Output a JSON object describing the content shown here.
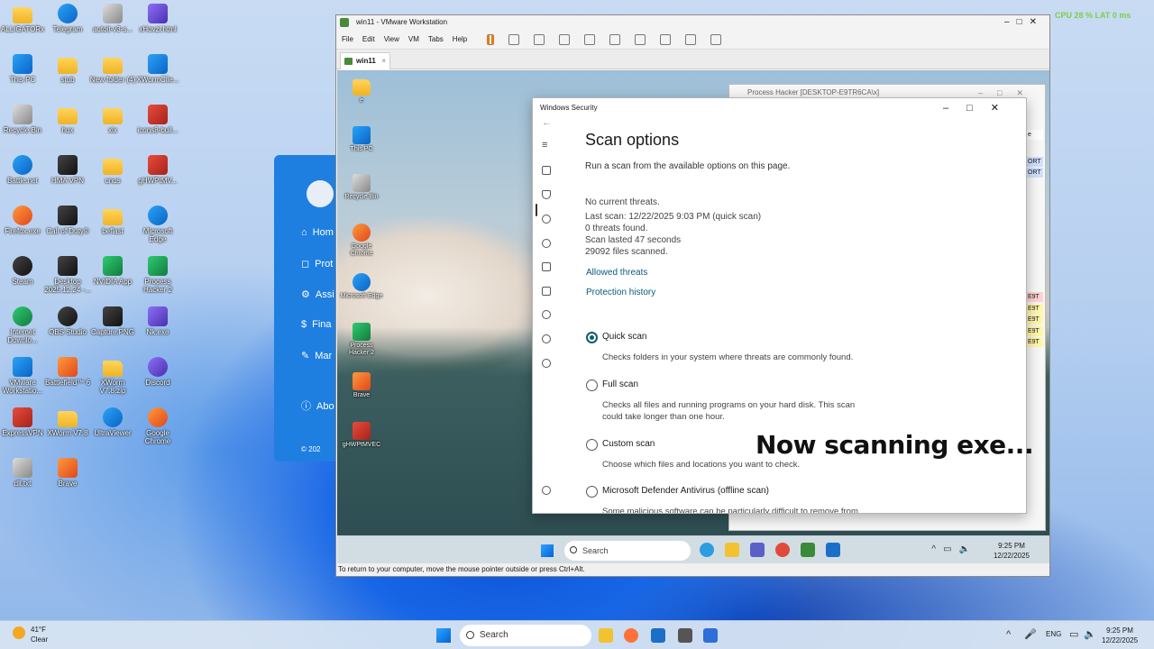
{
  "desktop": {
    "icons": [
      {
        "label": "ALLIGATORx",
        "glyph": "folder"
      },
      {
        "label": "Telegram",
        "glyph": "blue-round"
      },
      {
        "label": "autoit-v3-s...",
        "glyph": "gray"
      },
      {
        "label": "xHovzi.html",
        "glyph": "purple"
      },
      {
        "label": "This PC",
        "glyph": "blue"
      },
      {
        "label": "stub",
        "glyph": "folder"
      },
      {
        "label": "New folder (4)",
        "glyph": "folder"
      },
      {
        "label": "XWormClie...",
        "glyph": "blue"
      },
      {
        "label": "Recycle Bin",
        "glyph": "gray"
      },
      {
        "label": "hux",
        "glyph": "folder"
      },
      {
        "label": "xix",
        "glyph": "folder"
      },
      {
        "label": "icons8-bull...",
        "glyph": "red"
      },
      {
        "label": "Battle.net",
        "glyph": "blue-round"
      },
      {
        "label": "HMA VPN",
        "glyph": "dark"
      },
      {
        "label": "unus",
        "glyph": "folder"
      },
      {
        "label": "gHWPtMV...",
        "glyph": "red"
      },
      {
        "label": "Firefox.exe",
        "glyph": "orange-round"
      },
      {
        "label": "Call of Duty®",
        "glyph": "dark"
      },
      {
        "label": "beflast",
        "glyph": "folder"
      },
      {
        "label": "Microsoft Edge",
        "glyph": "blue-round"
      },
      {
        "label": "Steam",
        "glyph": "dark-round"
      },
      {
        "label": "Desktop 2025.12.24 -...",
        "glyph": "dark"
      },
      {
        "label": "NVIDIA App",
        "glyph": "green"
      },
      {
        "label": "Process Hacker 2",
        "glyph": "green"
      },
      {
        "label": "Internet Downlo...",
        "glyph": "green-round"
      },
      {
        "label": "OBS Studio",
        "glyph": "dark-round"
      },
      {
        "label": "Capture.PNG",
        "glyph": "dark"
      },
      {
        "label": "Nk.exe",
        "glyph": "purple"
      },
      {
        "label": "VMware Workstatio...",
        "glyph": "blue"
      },
      {
        "label": "Battlefield™ 6",
        "glyph": "orange"
      },
      {
        "label": "XWorm V7.8.zip",
        "glyph": "folder"
      },
      {
        "label": "Discord",
        "glyph": "purple-round"
      },
      {
        "label": "ExpressVPN",
        "glyph": "red"
      },
      {
        "label": "XWorm V7.8",
        "glyph": "folder"
      },
      {
        "label": "UltraViewer",
        "glyph": "blue-round"
      },
      {
        "label": "Google Chrome",
        "glyph": "orange-round"
      },
      {
        "label": "dll.txt",
        "glyph": "gray"
      },
      {
        "label": "Brave",
        "glyph": "orange"
      }
    ]
  },
  "side_app": {
    "nav": [
      "Hom",
      "Prot",
      "Assi",
      "Fina",
      "Mar",
      "Abo"
    ],
    "footer": "© 202"
  },
  "vmware": {
    "title": "win11 - VMware Workstation",
    "menu": [
      "File",
      "Edit",
      "View",
      "VM",
      "Tabs",
      "Help"
    ],
    "tab_label": "win11",
    "status_text": "To return to your computer, move the mouse pointer outside or press Ctrl+Alt."
  },
  "guest": {
    "icons": [
      {
        "label": "e",
        "glyph": "folder"
      },
      {
        "label": "This PC",
        "glyph": "blue"
      },
      {
        "label": "Recycle Bin",
        "glyph": "gray"
      },
      {
        "label": "Google Chrome",
        "glyph": "orange-round"
      },
      {
        "label": "Microsoft Edge",
        "glyph": "blue-round"
      },
      {
        "label": "Process Hacker 2",
        "glyph": "green"
      },
      {
        "label": "Brave",
        "glyph": "orange"
      },
      {
        "label": "gHWPtMVEC",
        "glyph": "red"
      }
    ],
    "process_hacker": {
      "title": "Process Hacker [DESKTOP-E9TR6CA\\x]",
      "rows": [
        "e",
        "ORT",
        "ORT",
        "E9T",
        "E9T",
        "E9T",
        "E9T",
        "E9T"
      ]
    },
    "taskbar": {
      "search": "Search",
      "time": "9:25 PM",
      "date": "12/22/2025"
    }
  },
  "windows_security": {
    "window_title": "Windows Security",
    "heading": "Scan options",
    "subtitle": "Run a scan from the available options on this page.",
    "status": [
      "No current threats.",
      "Last scan: 12/22/2025 9:03 PM (quick scan)",
      "0 threats found.",
      "Scan lasted 47 seconds",
      "29092 files scanned."
    ],
    "links": [
      "Allowed threats",
      "Protection history"
    ],
    "options": [
      {
        "label": "Quick scan",
        "desc": "Checks folders in your system where threats are commonly found.",
        "selected": true
      },
      {
        "label": "Full scan",
        "desc": "Checks all files and running programs on your hard disk. This scan could take longer than one hour.",
        "selected": false
      },
      {
        "label": "Custom scan",
        "desc": "Choose which files and locations you want to check.",
        "selected": false
      },
      {
        "label": "Microsoft Defender Antivirus (offline scan)",
        "desc": "Some malicious software can be particularly difficult to remove from",
        "selected": false
      }
    ]
  },
  "overlay_caption": "Now scanning exe...",
  "hud": "CPU 28 %    LAT 0 ms",
  "host_taskbar": {
    "weather_temp": "41°F",
    "weather_desc": "Clear",
    "search": "Search",
    "lang": "ENG",
    "time": "9:25 PM",
    "date": "12/22/2025"
  },
  "colors": {
    "accent_teal": "#0e5d6e",
    "link": "#0a5a7a",
    "hud_green": "#7ad04a"
  }
}
